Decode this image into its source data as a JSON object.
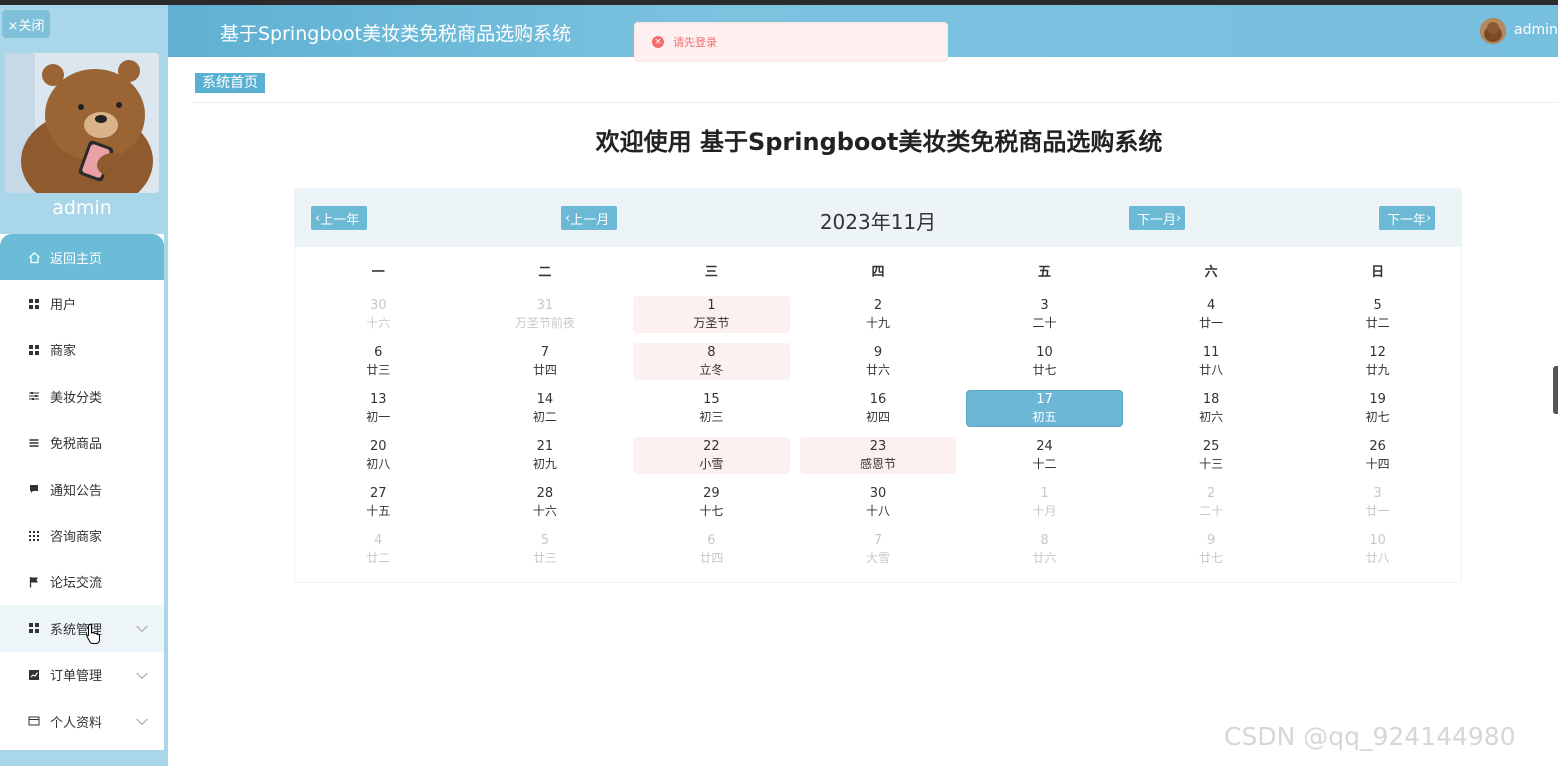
{
  "app": {
    "title": "基于Springboot美妆类免税商品选购系统",
    "user": "admin"
  },
  "sidebar": {
    "close_label": "×关闭",
    "username": "admin",
    "items": [
      {
        "label": "返回主页",
        "icon": "home-icon"
      },
      {
        "label": "用户",
        "icon": "grid-icon"
      },
      {
        "label": "商家",
        "icon": "grid-icon"
      },
      {
        "label": "美妆分类",
        "icon": "sliders-icon"
      },
      {
        "label": "免税商品",
        "icon": "list-icon"
      },
      {
        "label": "通知公告",
        "icon": "message-icon"
      },
      {
        "label": "咨询商家",
        "icon": "apps-icon"
      },
      {
        "label": "论坛交流",
        "icon": "flag-icon"
      },
      {
        "label": "系统管理",
        "icon": "grid-icon"
      },
      {
        "label": "订单管理",
        "icon": "chart-icon"
      },
      {
        "label": "个人资料",
        "icon": "card-icon"
      }
    ]
  },
  "toast": {
    "message": "请先登录",
    "type": "error"
  },
  "breadcrumb": "系统首页",
  "welcome": "欢迎使用 基于Springboot美妆类免税商品选购系统",
  "calendar": {
    "title": "2023年11月",
    "prev_year": "上一年",
    "prev_month": "上一月",
    "next_month": "下一月",
    "next_year": "下一年",
    "weekdays": [
      "一",
      "二",
      "三",
      "四",
      "五",
      "六",
      "日"
    ],
    "weeks": [
      [
        {
          "d": "30",
          "l": "十六",
          "other": true
        },
        {
          "d": "31",
          "l": "万圣节前夜",
          "other": true
        },
        {
          "d": "1",
          "l": "万圣节",
          "holiday": true
        },
        {
          "d": "2",
          "l": "十九"
        },
        {
          "d": "3",
          "l": "二十"
        },
        {
          "d": "4",
          "l": "廿一"
        },
        {
          "d": "5",
          "l": "廿二"
        }
      ],
      [
        {
          "d": "6",
          "l": "廿三"
        },
        {
          "d": "7",
          "l": "廿四"
        },
        {
          "d": "8",
          "l": "立冬",
          "holiday": true
        },
        {
          "d": "9",
          "l": "廿六"
        },
        {
          "d": "10",
          "l": "廿七"
        },
        {
          "d": "11",
          "l": "廿八"
        },
        {
          "d": "12",
          "l": "廿九"
        }
      ],
      [
        {
          "d": "13",
          "l": "初一"
        },
        {
          "d": "14",
          "l": "初二"
        },
        {
          "d": "15",
          "l": "初三"
        },
        {
          "d": "16",
          "l": "初四"
        },
        {
          "d": "17",
          "l": "初五",
          "today": true
        },
        {
          "d": "18",
          "l": "初六"
        },
        {
          "d": "19",
          "l": "初七"
        }
      ],
      [
        {
          "d": "20",
          "l": "初八"
        },
        {
          "d": "21",
          "l": "初九"
        },
        {
          "d": "22",
          "l": "小雪",
          "holiday": true
        },
        {
          "d": "23",
          "l": "感恩节",
          "holiday": true
        },
        {
          "d": "24",
          "l": "十二"
        },
        {
          "d": "25",
          "l": "十三"
        },
        {
          "d": "26",
          "l": "十四"
        }
      ],
      [
        {
          "d": "27",
          "l": "十五"
        },
        {
          "d": "28",
          "l": "十六"
        },
        {
          "d": "29",
          "l": "十七"
        },
        {
          "d": "30",
          "l": "十八"
        },
        {
          "d": "1",
          "l": "十月",
          "other": true
        },
        {
          "d": "2",
          "l": "二十",
          "other": true
        },
        {
          "d": "3",
          "l": "廿一",
          "other": true
        }
      ],
      [
        {
          "d": "4",
          "l": "廿二",
          "other": true
        },
        {
          "d": "5",
          "l": "廿三",
          "other": true
        },
        {
          "d": "6",
          "l": "廿四",
          "other": true
        },
        {
          "d": "7",
          "l": "大雪",
          "other": true
        },
        {
          "d": "8",
          "l": "廿六",
          "other": true
        },
        {
          "d": "9",
          "l": "廿七",
          "other": true
        },
        {
          "d": "10",
          "l": "廿八",
          "other": true
        }
      ]
    ]
  },
  "watermark": "CSDN @qq_924144980",
  "colors": {
    "accent": "#6cb9d6",
    "sidebar": "#a9d6e8",
    "error": "#f56c6c"
  }
}
